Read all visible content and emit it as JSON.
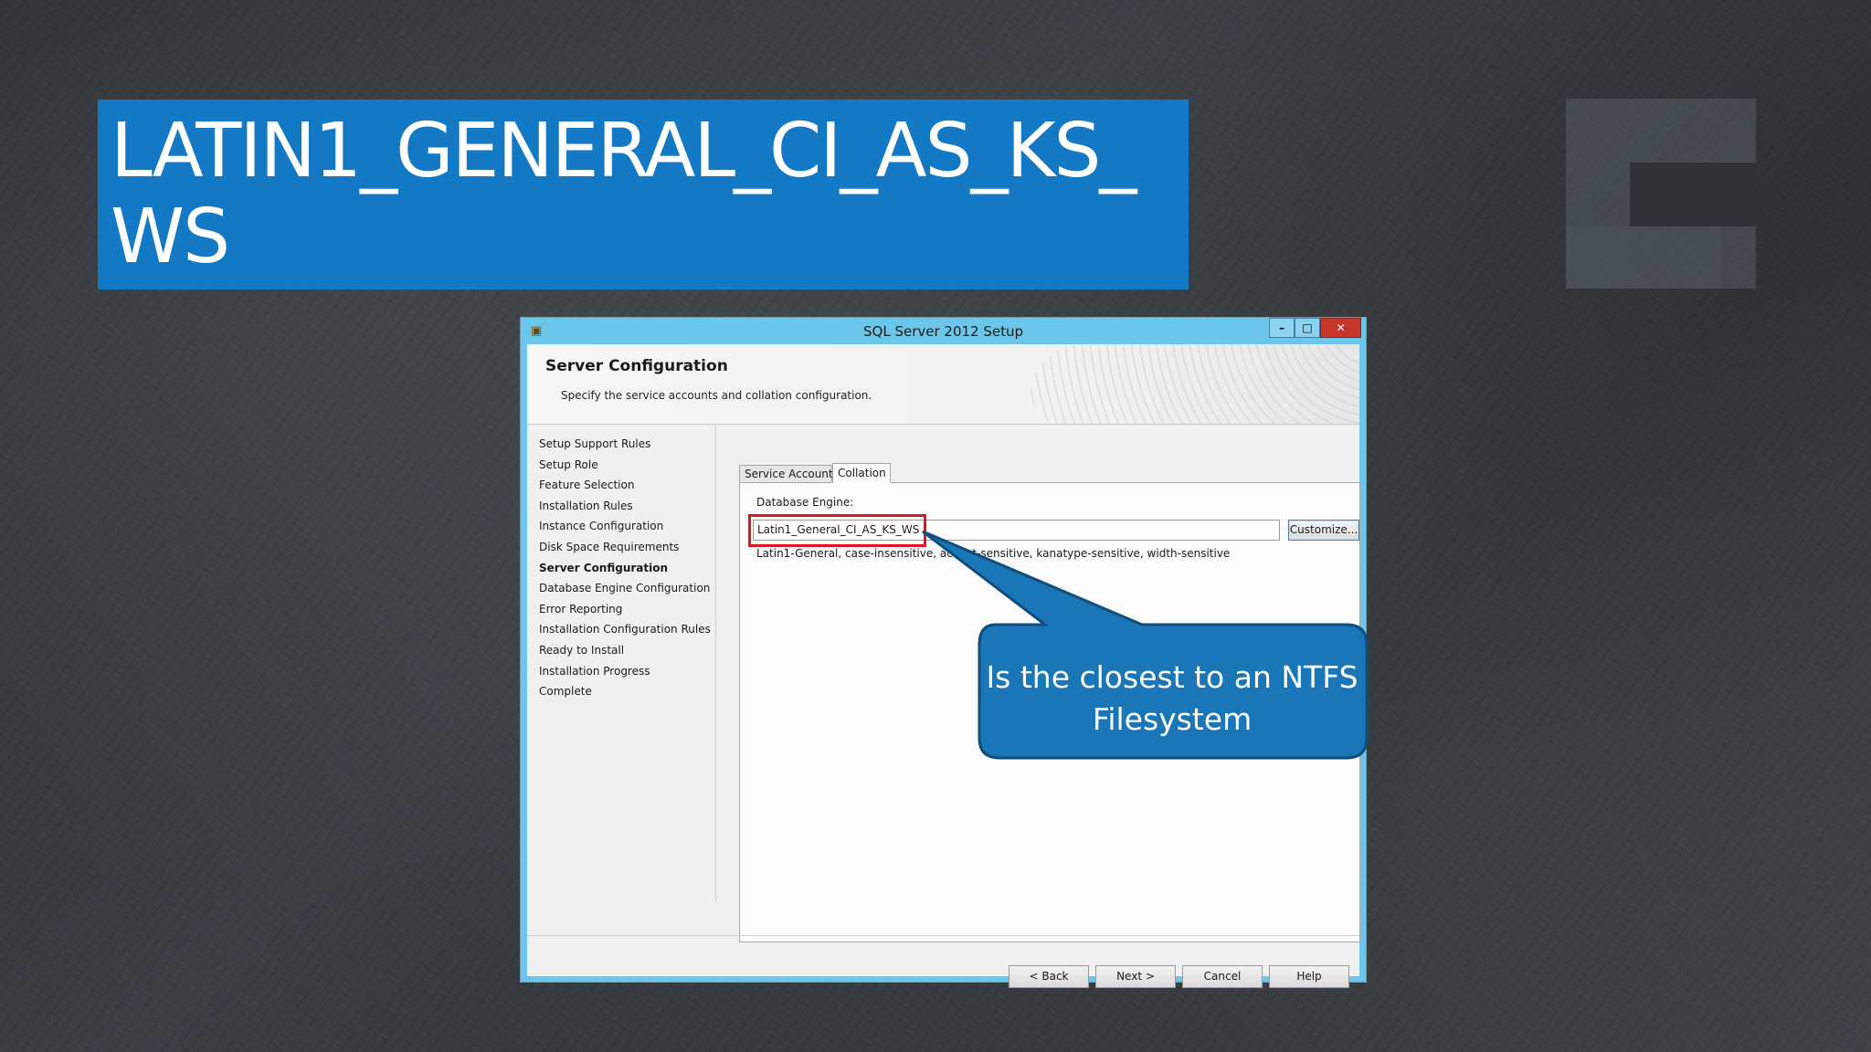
{
  "slide": {
    "title": "LATIN1_GENERAL_CI_AS_KS_WS"
  },
  "window": {
    "title": "SQL Server 2012 Setup",
    "icon": "setup-box-icon",
    "controls": {
      "minimize": "–",
      "maximize": "□",
      "close": "✕"
    }
  },
  "header": {
    "title": "Server Configuration",
    "description": "Specify the service accounts and collation configuration."
  },
  "nav": {
    "items": [
      {
        "label": "Setup Support Rules",
        "active": false
      },
      {
        "label": "Setup Role",
        "active": false
      },
      {
        "label": "Feature Selection",
        "active": false
      },
      {
        "label": "Installation Rules",
        "active": false
      },
      {
        "label": "Instance Configuration",
        "active": false
      },
      {
        "label": "Disk Space Requirements",
        "active": false
      },
      {
        "label": "Server Configuration",
        "active": true
      },
      {
        "label": "Database Engine Configuration",
        "active": false
      },
      {
        "label": "Error Reporting",
        "active": false
      },
      {
        "label": "Installation Configuration Rules",
        "active": false
      },
      {
        "label": "Ready to Install",
        "active": false
      },
      {
        "label": "Installation Progress",
        "active": false
      },
      {
        "label": "Complete",
        "active": false
      }
    ]
  },
  "tabs": [
    {
      "label": "Service Accounts",
      "selected": false
    },
    {
      "label": "Collation",
      "selected": true
    }
  ],
  "collation": {
    "field_label": "Database Engine:",
    "value": "Latin1_General_CI_AS_KS_WS",
    "customize_label": "Customize...",
    "description": "Latin1-General, case-insensitive, accent-sensitive, kanatype-sensitive, width-sensitive"
  },
  "footer": {
    "back_label": "< Back",
    "next_label": "Next >",
    "cancel_label": "Cancel",
    "help_label": "Help"
  },
  "callout": {
    "text": "Is the closest to an NTFS Filesystem",
    "fill": "#1a76b6",
    "stroke": "#0f4d7d"
  },
  "colors": {
    "title_bar_blue": "#1479c4",
    "window_chrome": "#6cc6ea",
    "highlight_red": "#e0141e"
  }
}
